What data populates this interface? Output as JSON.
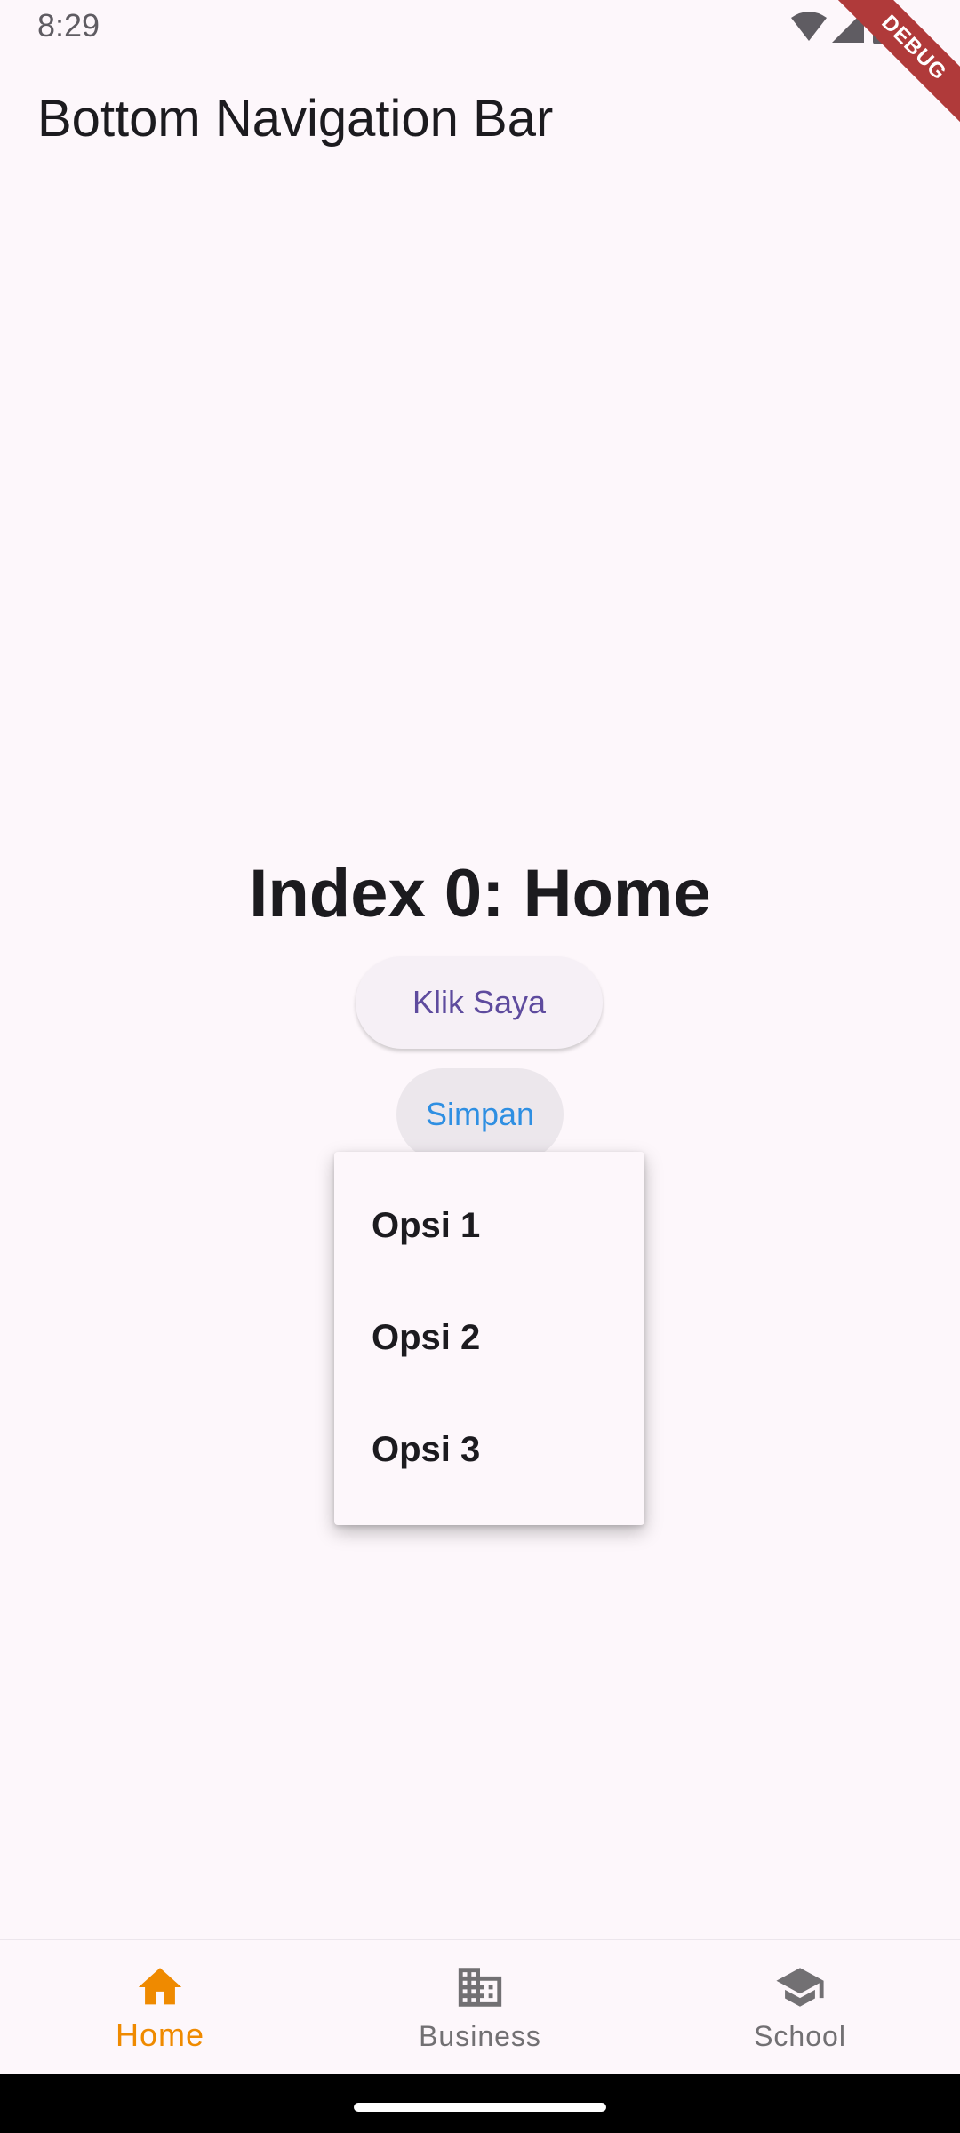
{
  "status_bar": {
    "time": "8:29",
    "icons": [
      "wifi-icon",
      "signal-icon",
      "battery-icon"
    ]
  },
  "debug_banner": "DEBUG",
  "app_bar": {
    "title": "Bottom Navigation Bar"
  },
  "main": {
    "heading": "Index 0: Home",
    "klik_button": "Klik Saya",
    "simpan_button": "Simpan"
  },
  "dropdown": {
    "items": [
      "Opsi 1",
      "Opsi 2",
      "Opsi 3"
    ]
  },
  "bottom_nav": {
    "items": [
      {
        "label": "Home",
        "icon": "home-icon",
        "selected": true
      },
      {
        "label": "Business",
        "icon": "business-icon",
        "selected": false
      },
      {
        "label": "School",
        "icon": "school-icon",
        "selected": false
      }
    ]
  },
  "colors": {
    "background": "#fdf7fb",
    "selected_nav": "#ef8a00",
    "unselected_nav": "#727073",
    "klik_text": "#5e4b9e",
    "simpan_text": "#2f8fe2"
  }
}
